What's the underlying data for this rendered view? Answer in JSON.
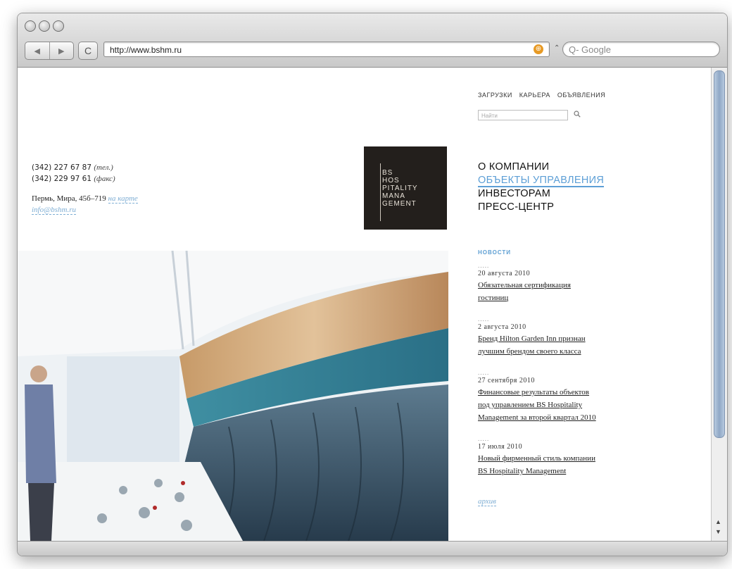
{
  "browser": {
    "url": "http://www.bshm.ru",
    "search_placeholder": "Q- Google",
    "back_label": "◀",
    "forward_label": "▶",
    "reload_label": "C",
    "rss_label": "⊕",
    "caret_label": "⌃"
  },
  "site": {
    "top_nav": [
      "ЗАГРУЗКИ",
      "КАРЬЕРА",
      "ОБЪЯВЛЕНИЯ"
    ],
    "search_placeholder": "Найти",
    "contacts": {
      "phone": "(342) 227 67 87",
      "phone_note": "(тел.)",
      "fax": "(342) 229 97 61",
      "fax_note": "(факс)",
      "address": "Пермь, Мира, 45б–719",
      "map_link": "на карте",
      "email": "info@bshm.ru"
    },
    "logo_lines": [
      "BS",
      "HOS",
      "PITALITY",
      "MANA",
      "GEMENT"
    ],
    "main_nav": [
      "О КОМПАНИИ",
      "ОБЪЕКТЫ УПРАВЛЕНИЯ",
      "ИНВЕСТОРАМ",
      "ПРЕСС-ЦЕНТР"
    ],
    "main_nav_active_index": 1,
    "news_header": "НОВОСТИ",
    "news": [
      {
        "date": "20 августа 2010",
        "title_lines": [
          "Обязательная сертификация",
          "гостиниц"
        ]
      },
      {
        "date": "2 августа 2010",
        "title_lines": [
          "Бренд Hilton Garden Inn признан",
          "лучшим брендом своего класса"
        ]
      },
      {
        "date": "27 сентября 2010",
        "title_lines": [
          "Финансовые результаты объектов",
          "под управлением BS Hospitality",
          "Management за второй квартал 2010"
        ]
      },
      {
        "date": "17 июля 2010",
        "title_lines": [
          "Новый фирменный стиль компании",
          "BS Hospitality Management"
        ]
      }
    ],
    "news_separator": ".....",
    "archive_link": "архив",
    "accent_color": "#5d9fd6"
  }
}
